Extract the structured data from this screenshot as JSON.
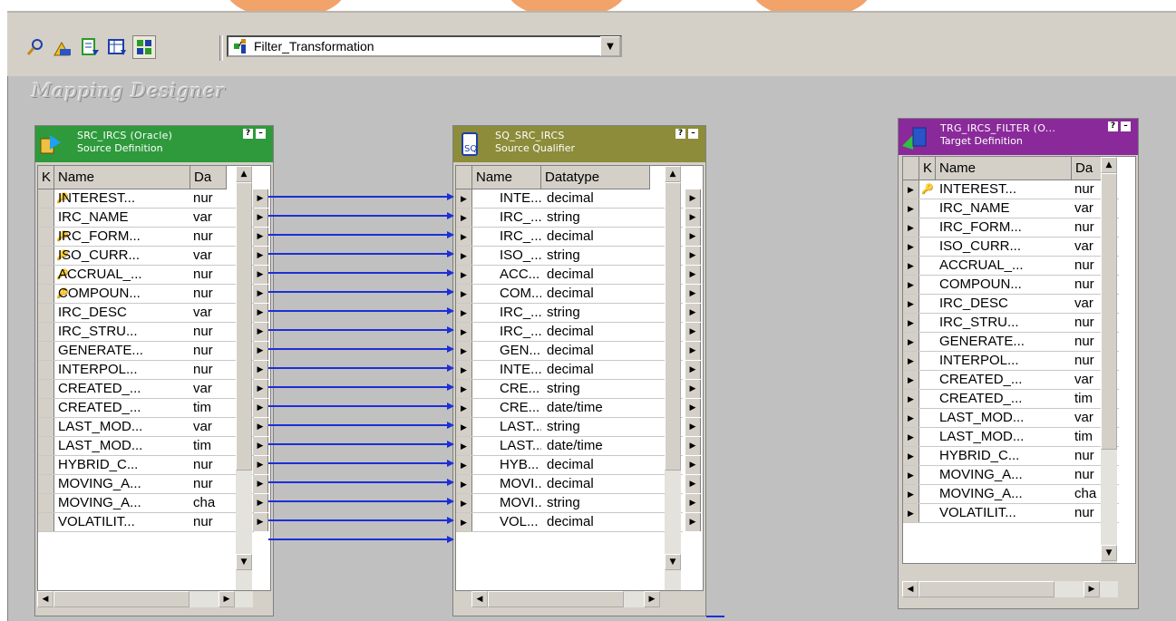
{
  "toolbar": {
    "buttons": [
      {
        "icon": "arrange-icon"
      },
      {
        "icon": "autolink-icon"
      },
      {
        "icon": "edit-icon"
      },
      {
        "icon": "table-icon"
      },
      {
        "icon": "tile-icon",
        "pressed": true
      }
    ],
    "mapping_select": {
      "value": "Filter_Transformation",
      "icon": "mapping-icon"
    }
  },
  "canvas": {
    "title": "Mapping Designer"
  },
  "source": {
    "title": "SRC_IRCS (Oracle)",
    "subtitle": "Source Definition",
    "header_color": "#2e9a3c",
    "columns": [
      "K",
      "Name",
      "Da"
    ],
    "rows": [
      {
        "key": true,
        "name": "INTEREST...",
        "type": "nur"
      },
      {
        "key": false,
        "name": "IRC_NAME",
        "type": "var"
      },
      {
        "key": true,
        "name": "IRC_FORM...",
        "type": "nur"
      },
      {
        "key": true,
        "name": "ISO_CURR...",
        "type": "var"
      },
      {
        "key": true,
        "name": "ACCRUAL_...",
        "type": "nur"
      },
      {
        "key": true,
        "name": "COMPOUN...",
        "type": "nur"
      },
      {
        "key": false,
        "name": "IRC_DESC",
        "type": "var"
      },
      {
        "key": false,
        "name": "IRC_STRU...",
        "type": "nur"
      },
      {
        "key": false,
        "name": "GENERATE...",
        "type": "nur"
      },
      {
        "key": false,
        "name": "INTERPOL...",
        "type": "nur"
      },
      {
        "key": false,
        "name": "CREATED_...",
        "type": "var"
      },
      {
        "key": false,
        "name": "CREATED_...",
        "type": "tim"
      },
      {
        "key": false,
        "name": "LAST_MOD...",
        "type": "var"
      },
      {
        "key": false,
        "name": "LAST_MOD...",
        "type": "tim"
      },
      {
        "key": false,
        "name": "HYBRID_C...",
        "type": "nur"
      },
      {
        "key": false,
        "name": "MOVING_A...",
        "type": "nur"
      },
      {
        "key": false,
        "name": "MOVING_A...",
        "type": "cha"
      },
      {
        "key": false,
        "name": "VOLATILIT...",
        "type": "nur"
      }
    ]
  },
  "qualifier": {
    "title": "SQ_SRC_IRCS",
    "subtitle": "Source Qualifier",
    "header_color": "#8c8c3a",
    "columns": [
      "Name",
      "Datatype"
    ],
    "rows": [
      {
        "name": "INTE...",
        "type": "decimal"
      },
      {
        "name": "IRC_...",
        "type": "string"
      },
      {
        "name": "IRC_...",
        "type": "decimal"
      },
      {
        "name": "ISO_...",
        "type": "string"
      },
      {
        "name": "ACC...",
        "type": "decimal"
      },
      {
        "name": "COM...",
        "type": "decimal"
      },
      {
        "name": "IRC_...",
        "type": "string"
      },
      {
        "name": "IRC_...",
        "type": "decimal"
      },
      {
        "name": "GEN...",
        "type": "decimal"
      },
      {
        "name": "INTE...",
        "type": "decimal"
      },
      {
        "name": "CRE...",
        "type": "string"
      },
      {
        "name": "CRE...",
        "type": "date/time"
      },
      {
        "name": "LAST...",
        "type": "string"
      },
      {
        "name": "LAST...",
        "type": "date/time"
      },
      {
        "name": "HYB...",
        "type": "decimal"
      },
      {
        "name": "MOVI...",
        "type": "decimal"
      },
      {
        "name": "MOVI...",
        "type": "string"
      },
      {
        "name": "VOL...",
        "type": "decimal"
      }
    ]
  },
  "target": {
    "title": "TRG_IRCS_FILTER (O...",
    "subtitle": "Target Definition",
    "header_color": "#8a2a9a",
    "columns": [
      "K",
      "Name",
      "Da"
    ],
    "rows": [
      {
        "key": true,
        "name": "INTEREST...",
        "type": "nur"
      },
      {
        "key": false,
        "name": "IRC_NAME",
        "type": "var"
      },
      {
        "key": false,
        "name": "IRC_FORM...",
        "type": "nur"
      },
      {
        "key": false,
        "name": "ISO_CURR...",
        "type": "var"
      },
      {
        "key": false,
        "name": "ACCRUAL_...",
        "type": "nur"
      },
      {
        "key": false,
        "name": "COMPOUN...",
        "type": "nur"
      },
      {
        "key": false,
        "name": "IRC_DESC",
        "type": "var"
      },
      {
        "key": false,
        "name": "IRC_STRU...",
        "type": "nur"
      },
      {
        "key": false,
        "name": "GENERATE...",
        "type": "nur"
      },
      {
        "key": false,
        "name": "INTERPOL...",
        "type": "nur"
      },
      {
        "key": false,
        "name": "CREATED_...",
        "type": "var"
      },
      {
        "key": false,
        "name": "CREATED_...",
        "type": "tim"
      },
      {
        "key": false,
        "name": "LAST_MOD...",
        "type": "var"
      },
      {
        "key": false,
        "name": "LAST_MOD...",
        "type": "tim"
      },
      {
        "key": false,
        "name": "HYBRID_C...",
        "type": "nur"
      },
      {
        "key": false,
        "name": "MOVING_A...",
        "type": "nur"
      },
      {
        "key": false,
        "name": "MOVING_A...",
        "type": "cha"
      },
      {
        "key": false,
        "name": "VOLATILIT...",
        "type": "nur"
      }
    ]
  },
  "link_color": "#1c2fd6"
}
